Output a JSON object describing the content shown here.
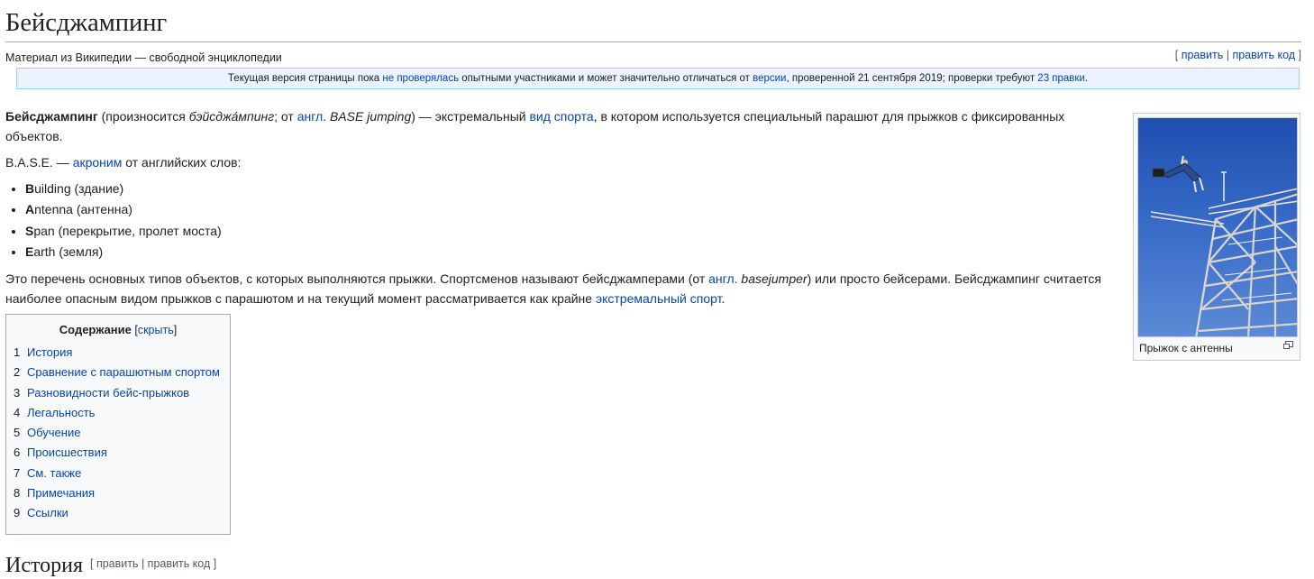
{
  "article": {
    "title": "Бейсджампинг",
    "from_wikipedia": "Материал из Википедии — свободной энциклопедии",
    "edit_link": "править",
    "edit_code_link": "править код",
    "open_bracket": "[ ",
    "close_bracket": " ]",
    "separator": " | "
  },
  "flagged_revs": {
    "t1": "Текущая версия страницы пока ",
    "l1": "не проверялась",
    "t2": " опытными участниками и может значительно отличаться от ",
    "l2": "версии",
    "t3": ", проверенной 21 сентября 2019; проверки требуют ",
    "l3": "23 правки",
    "t4": "."
  },
  "lead": {
    "p1": {
      "b": "Бейсджампинг",
      "t1": " (произносится ",
      "i1": "бэйсджа́мпинг",
      "t2": "; от ",
      "l1": "англ.",
      "t3": " ",
      "i2": "BASE jumping",
      "t4": ") — экстремальный ",
      "l2": "вид спорта",
      "t5": ", в котором используется специальный парашют для прыжков с фиксированных объектов."
    },
    "p2": {
      "t1": "B.A.S.E. — ",
      "l1": "акроним",
      "t2": " от английских слов:"
    },
    "list": [
      {
        "letter": "B",
        "rest": "uilding (здание)"
      },
      {
        "letter": "A",
        "rest": "ntenna (антенна)"
      },
      {
        "letter": "S",
        "rest": "pan (перекрытие, пролет моста)"
      },
      {
        "letter": "E",
        "rest": "arth (земля)"
      }
    ],
    "p3": {
      "t1": "Это перечень основных типов объектов, с которых выполняются прыжки. Спортсменов называют бейсджамперами (от ",
      "l1": "англ.",
      "t2": " ",
      "i1": "basejumper",
      "t3": ") или просто бейсерами. Бейсджампинг считается наиболее опасным видом прыжков с парашютом и на текущий момент рассматривается как крайне ",
      "l2": "экстремальный спорт",
      "t4": "."
    }
  },
  "thumbnail": {
    "caption": "Прыжок с антенны",
    "magnify_icon": "enlarge-icon"
  },
  "toc": {
    "title": "Содержание",
    "toggle_open": " [",
    "toggle": "скрыть",
    "toggle_close": "]",
    "items": [
      {
        "num": "1",
        "label": "История"
      },
      {
        "num": "2",
        "label": "Сравнение с парашютным спортом"
      },
      {
        "num": "3",
        "label": "Разновидности бейс-прыжков"
      },
      {
        "num": "4",
        "label": "Легальность"
      },
      {
        "num": "5",
        "label": "Обучение"
      },
      {
        "num": "6",
        "label": "Происшествия"
      },
      {
        "num": "7",
        "label": "См. также"
      },
      {
        "num": "8",
        "label": "Примечания"
      },
      {
        "num": "9",
        "label": "Ссылки"
      }
    ]
  },
  "section": {
    "heading": "История",
    "edit_links": "[ править | править код ]"
  },
  "colors": {
    "link": "#0645ad",
    "text": "#202122",
    "notice_bg": "#eaf3ff",
    "notice_border": "#a3caff",
    "sky": "#3569c6"
  }
}
